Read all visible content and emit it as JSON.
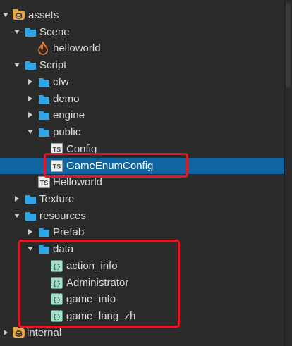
{
  "tree": {
    "assets": "assets",
    "scene": "Scene",
    "helloworld_scene": "helloworld",
    "script": "Script",
    "cfw": "cfw",
    "demo": "demo",
    "engine": "engine",
    "public": "public",
    "config": "Config",
    "game_enum_config": "GameEnumConfig",
    "helloworld_script": "Helloworld",
    "texture": "Texture",
    "resources": "resources",
    "prefab": "Prefab",
    "data": "data",
    "action_info": "action_info",
    "administrator": "Administrator",
    "game_info": "game_info",
    "game_lang_zh": "game_lang_zh",
    "internal": "internal"
  },
  "icons": {
    "ts": "TS",
    "json": "{}"
  },
  "colors": {
    "folder": "#2fa6e8",
    "selection": "#1065a3",
    "highlight": "#e0182a",
    "db_folder": "#e5a94a"
  }
}
